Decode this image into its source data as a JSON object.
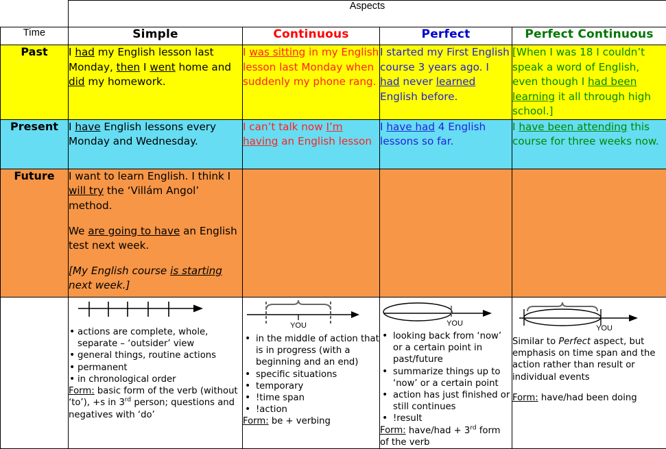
{
  "table": {
    "aspects_header": "Aspects",
    "time_header": "Time",
    "columns": [
      {
        "label": "Simple",
        "color": "#000000"
      },
      {
        "label": "Continuous",
        "color": "#ff0000"
      },
      {
        "label": "Perfect",
        "color": "#0000cc"
      },
      {
        "label": "Perfect Continuous",
        "color": "#007700"
      }
    ],
    "rows": [
      {
        "time": "Past",
        "fill": "#ffff00",
        "simple": "I <u>had</u> my English lesson last Monday, <u>then</u> I <u>went</u> home and <u>did</u> my homework.",
        "continuous": "I <u>was sitting</u> in my English lesson last Monday when suddenly my phone rang.",
        "perfect": "I started my First English course 3 years ago. I <u>had</u> never <u>learned</u> English before.",
        "perfect_continuous": "[When I was 18 I couldn&rsquo;t speak a word of English, even though I <u>had been learning</u> it all through high school.]"
      },
      {
        "time": "Present",
        "fill": "#66ddf2",
        "simple": "I <u>have</u> English lessons every Monday and Wednesday.",
        "continuous": "I can&rsquo;t talk now <u>I&rsquo;m having</u> an English lesson",
        "perfect": "I <u>have had</u> 4 English lessons so far.",
        "perfect_continuous": "I <u>have been attending</u> this course for three weeks now."
      },
      {
        "time": "Future",
        "fill": "#f79646",
        "simple": "<p>I want to learn English. I think I <u>will try</u> the &lsquo;Vill&aacute;m Angol&rsquo; method.</p><p>We <u>are going to have</u> an English test next week.</p><p><i>[My English course <u>is starting</u> next week.]</i></p>",
        "continuous": "",
        "perfect": "",
        "perfect_continuous": ""
      }
    ],
    "explanations": {
      "time_cell": "",
      "simple": {
        "diagram": "timeline-with-ticks",
        "bullets": [
          "actions are complete, whole, separate &ndash; &lsquo;outsider&rsquo; view",
          "general things, routine actions",
          "permanent",
          "in chronological order"
        ],
        "form_label": "Form:",
        "form_text": " basic form of the verb (without &lsquo;to&rsquo;), +s in 3<sup>rd</sup> person; questions and negatives with &lsquo;do&rsquo;"
      },
      "continuous": {
        "diagram": "timeline-brace-you",
        "diagram_you_label": "YOU",
        "bullets": [
          "in the middle of action that is in progress (with a beginning and an end)",
          "specific situations",
          "temporary",
          "!time span",
          "!action"
        ],
        "form_label": "Form:",
        "form_text": " be + verbing"
      },
      "perfect": {
        "diagram": "timeline-ellipse-you",
        "diagram_you_label": "YOU",
        "bullets": [
          "looking back from &lsquo;now&rsquo; or a certain point in past/future",
          "summarize things up to &lsquo;now&rsquo; or a certain point",
          "action has just finished or still continues",
          "!result"
        ],
        "form_label": "Form:",
        "form_text": " have/had + 3<sup>rd</sup> form of the verb"
      },
      "perfect_continuous": {
        "diagram": "timeline-ellipse-brace-you",
        "diagram_you_label": "YOU",
        "paragraph": "Similar to <i>Perfect</i> aspect, but emphasis on time span and the action rather than result or individual events",
        "form_label": "Form:",
        "form_text": " have/had been  doing"
      }
    }
  }
}
